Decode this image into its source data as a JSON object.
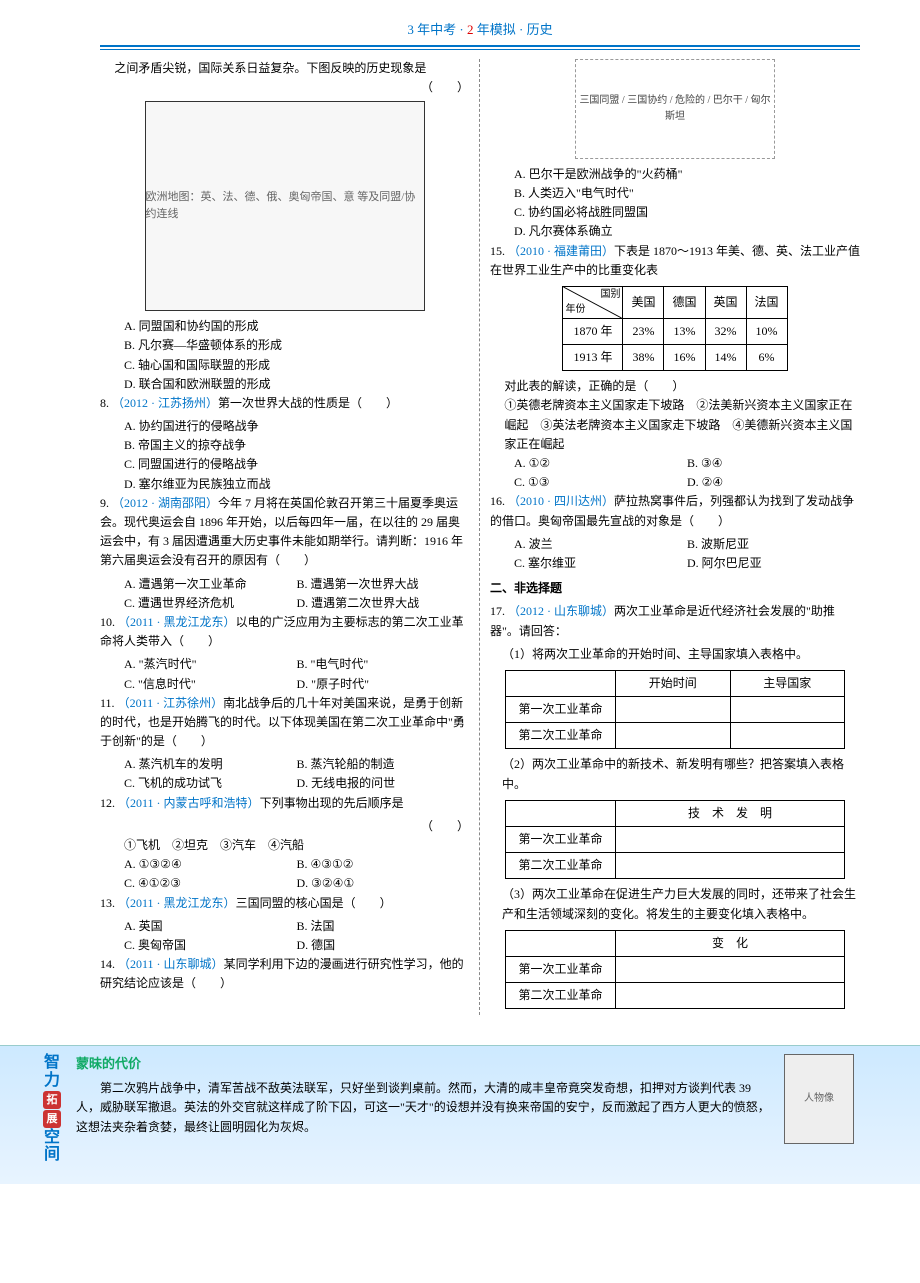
{
  "header": {
    "l": "3 年中考 · ",
    "m": "2",
    "r": " 年模拟 · 历史"
  },
  "q7": {
    "cont": "之间矛盾尖锐，国际关系日益复杂。下图反映的历史现象是",
    "paren": "（　　）",
    "map_note": "欧洲地图：英、法、德、俄、奥匈帝国、意 等及同盟/协约连线",
    "A": "A. 同盟国和协约国的形成",
    "B": "B. 凡尔赛—华盛顿体系的形成",
    "C": "C. 轴心国和国际联盟的形成",
    "D": "D. 联合国和欧洲联盟的形成"
  },
  "q8": {
    "num": "8. ",
    "src": "（2012 · 江苏扬州）",
    "stem": "第一次世界大战的性质是（　　）",
    "A": "A. 协约国进行的侵略战争",
    "B": "B. 帝国主义的掠夺战争",
    "C": "C. 同盟国进行的侵略战争",
    "D": "D. 塞尔维亚为民族独立而战"
  },
  "q9": {
    "num": "9. ",
    "src": "（2012 · 湖南邵阳）",
    "stem": "今年 7 月将在英国伦敦召开第三十届夏季奥运会。现代奥运会自 1896 年开始，以后每四年一届，在以往的 29 届奥运会中，有 3 届因遭遇重大历史事件未能如期举行。请判断：1916 年第六届奥运会没有召开的原因有（　　）",
    "A": "A. 遭遇第一次工业革命",
    "B": "B. 遭遇第一次世界大战",
    "C": "C. 遭遇世界经济危机",
    "D": "D. 遭遇第二次世界大战"
  },
  "q10": {
    "num": "10. ",
    "src": "（2011 · 黑龙江龙东）",
    "stem": "以电的广泛应用为主要标志的第二次工业革命将人类带入（　　）",
    "A": "A. \"蒸汽时代\"",
    "B": "B. \"电气时代\"",
    "C": "C. \"信息时代\"",
    "D": "D. \"原子时代\""
  },
  "q11": {
    "num": "11. ",
    "src": "（2011 · 江苏徐州）",
    "stem": "南北战争后的几十年对美国来说，是勇于创新的时代，也是开始腾飞的时代。以下体现美国在第二次工业革命中\"勇于创新\"的是（　　）",
    "A": "A. 蒸汽机车的发明",
    "B": "B. 蒸汽轮船的制造",
    "C": "C. 飞机的成功试飞",
    "D": "D. 无线电报的问世"
  },
  "q12": {
    "num": "12. ",
    "src": "（2011 · 内蒙古呼和浩特）",
    "stem": "下列事物出现的先后顺序是",
    "paren": "（　　）",
    "items": "①飞机　②坦克　③汽车　④汽船",
    "A": "A. ①③②④",
    "B": "B. ④③①②",
    "C": "C. ④①②③",
    "D": "D. ③②④①"
  },
  "q13": {
    "num": "13. ",
    "src": "（2011 · 黑龙江龙东）",
    "stem": "三国同盟的核心国是（　　）",
    "A": "A. 英国",
    "B": "B. 法国",
    "C": "C. 奥匈帝国",
    "D": "D. 德国"
  },
  "q14": {
    "num": "14. ",
    "src": "（2011 · 山东聊城）",
    "stem": "某同学利用下边的漫画进行研究性学习，他的研究结论应该是（　　）",
    "cartoon": "三国同盟 / 三国协约 / 危险的 / 巴尔干 / 匈尔斯坦",
    "A": "A. 巴尔干是欧洲战争的\"火药桶\"",
    "B": "B. 人类迈入\"电气时代\"",
    "C": "C. 协约国必将战胜同盟国",
    "D": "D. 凡尔赛体系确立"
  },
  "q15": {
    "num": "15. ",
    "src": "（2010 · 福建莆田）",
    "stem": "下表是 1870～1913 年美、德、英、法工业产值在世界工业生产中的比重变化表",
    "table": {
      "corner_top": "国别",
      "corner_bottom": "年份",
      "cols": [
        "美国",
        "德国",
        "英国",
        "法国"
      ],
      "rows": [
        {
          "year": "1870 年",
          "vals": [
            "23%",
            "13%",
            "32%",
            "10%"
          ]
        },
        {
          "year": "1913 年",
          "vals": [
            "38%",
            "16%",
            "14%",
            "6%"
          ]
        }
      ]
    },
    "after": "对此表的解读，正确的是（　　）",
    "items": "①英德老牌资本主义国家走下坡路　②法美新兴资本主义国家正在崛起　③英法老牌资本主义国家走下坡路　④美德新兴资本主义国家正在崛起",
    "A": "A. ①②",
    "B": "B. ③④",
    "C": "C. ①③",
    "D": "D. ②④"
  },
  "q16": {
    "num": "16. ",
    "src": "（2010 · 四川达州）",
    "stem": "萨拉热窝事件后，列强都认为找到了发动战争的借口。奥匈帝国最先宣战的对象是（　　）",
    "A": "A. 波兰",
    "B": "B. 波斯尼亚",
    "C": "C. 塞尔维亚",
    "D": "D. 阿尔巴尼亚"
  },
  "sec2": "二、非选择题",
  "q17": {
    "num": "17. ",
    "src": "（2012 · 山东聊城）",
    "stem": "两次工业革命是近代经济社会发展的\"助推器\"。请回答：",
    "p1": "（1）将两次工业革命的开始时间、主导国家填入表格中。",
    "t1": {
      "h1": "开始时间",
      "h2": "主导国家",
      "r1": "第一次工业革命",
      "r2": "第二次工业革命"
    },
    "p2": "（2）两次工业革命中的新技术、新发明有哪些？把答案填入表格中。",
    "t2": {
      "h": "技　术　发　明",
      "r1": "第一次工业革命",
      "r2": "第二次工业革命"
    },
    "p3": "（3）两次工业革命在促进生产力巨大发展的同时，还带来了社会生产和生活领域深刻的变化。将发生的主要变化填入表格中。",
    "t3": {
      "h": "变　化",
      "r1": "第一次工业革命",
      "r2": "第二次工业革命"
    }
  },
  "footer": {
    "side": [
      "智",
      "力",
      "拓",
      "展",
      "空",
      "间"
    ],
    "title": "蒙昧的代价",
    "body": "第二次鸦片战争中，清军苦战不敌英法联军，只好坐到谈判桌前。然而，大清的咸丰皇帝竟突发奇想，扣押对方谈判代表 39 人，威胁联军撤退。英法的外交官就这样成了阶下囚，可这一\"天才\"的设想并没有换来帝国的安宁，反而激起了西方人更大的愤怒，这想法夹杂着贪婪，最终让圆明园化为灰烬。",
    "img": "人物像"
  }
}
